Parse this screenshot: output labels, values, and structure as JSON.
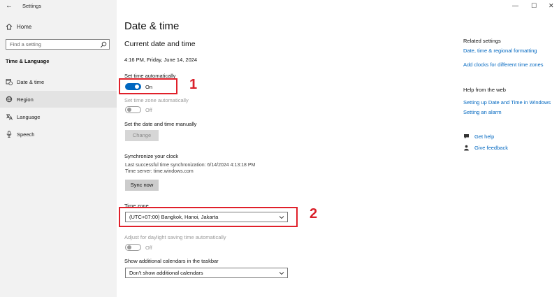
{
  "window": {
    "title": "Settings",
    "controls": {
      "minimize": "—",
      "maximize": "☐",
      "close": "✕"
    }
  },
  "sidebar": {
    "home_label": "Home",
    "search_placeholder": "Find a setting",
    "section": "Time & Language",
    "items": [
      {
        "label": "Date & time",
        "icon": "calendar-clock-icon",
        "selected": false
      },
      {
        "label": "Region",
        "icon": "globe-icon",
        "selected": true
      },
      {
        "label": "Language",
        "icon": "language-icon",
        "selected": false
      },
      {
        "label": "Speech",
        "icon": "microphone-icon",
        "selected": false
      }
    ]
  },
  "main": {
    "title": "Date & time",
    "subtitle": "Current date and time",
    "current_datetime": "4:16 PM, Friday, June 14, 2024",
    "set_time_auto": {
      "label": "Set time automatically",
      "state": "On"
    },
    "set_timezone_auto": {
      "label": "Set time zone automatically",
      "state": "Off"
    },
    "manual": {
      "label": "Set the date and time manually",
      "button": "Change"
    },
    "sync": {
      "heading": "Synchronize your clock",
      "last_sync": "Last successful time synchronization: 6/14/2024 4:13:18 PM",
      "server": "Time server: time.windows.com",
      "button": "Sync now"
    },
    "timezone": {
      "label": "Time zone",
      "value": "(UTC+07:00) Bangkok, Hanoi, Jakarta"
    },
    "dst": {
      "label": "Adjust for daylight saving time automatically",
      "state": "Off"
    },
    "calendars": {
      "label": "Show additional calendars in the taskbar",
      "value": "Don't show additional calendars"
    }
  },
  "annotations": {
    "marker1": "1",
    "marker2": "2",
    "color": "#e0202a"
  },
  "right": {
    "related_heading": "Related settings",
    "related_links": [
      "Date, time & regional formatting",
      "Add clocks for different time zones"
    ],
    "help_heading": "Help from the web",
    "help_links": [
      "Setting up Date and Time in Windows",
      "Setting an alarm"
    ],
    "get_help": "Get help",
    "feedback": "Give feedback"
  },
  "colors": {
    "accent": "#0067c0",
    "sidebar_bg": "#f2f2f2"
  }
}
